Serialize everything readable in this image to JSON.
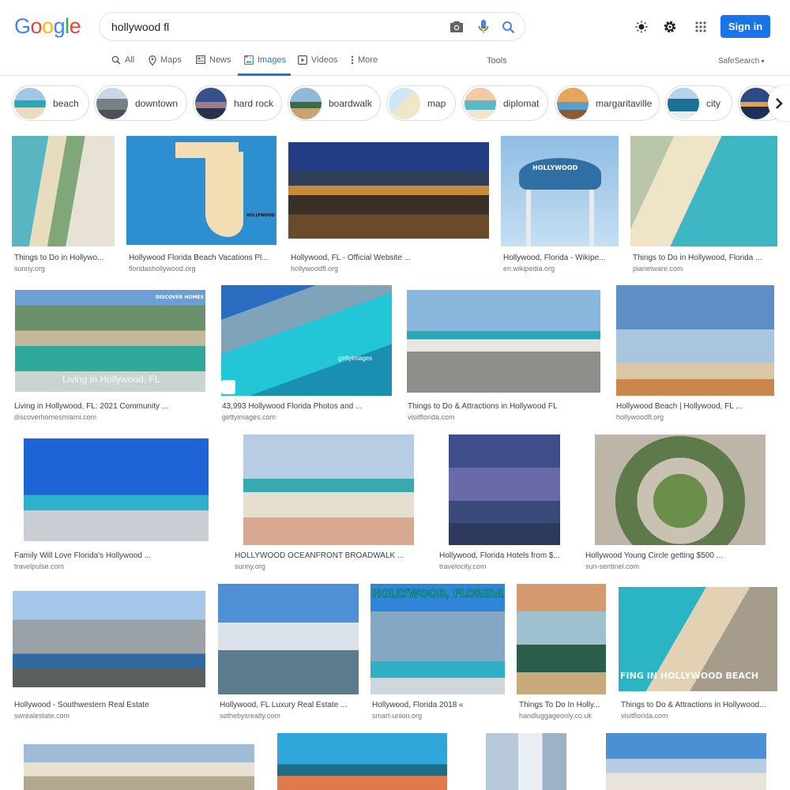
{
  "logo": {
    "letters": [
      "G",
      "o",
      "o",
      "g",
      "l",
      "e"
    ]
  },
  "search": {
    "query": "hollywood fl"
  },
  "header": {
    "signin_label": "Sign in"
  },
  "tabs": [
    {
      "label": "All",
      "icon": "search-icon"
    },
    {
      "label": "Maps",
      "icon": "map-pin-icon"
    },
    {
      "label": "News",
      "icon": "news-icon"
    },
    {
      "label": "Images",
      "icon": "image-icon",
      "active": true
    },
    {
      "label": "Videos",
      "icon": "video-icon"
    },
    {
      "label": "More",
      "icon": "more-vertical-icon"
    }
  ],
  "tools_label": "Tools",
  "safesearch_label": "SafeSearch",
  "chips": [
    {
      "label": "beach"
    },
    {
      "label": "downtown"
    },
    {
      "label": "hard rock"
    },
    {
      "label": "boardwalk"
    },
    {
      "label": "map"
    },
    {
      "label": "diplomat"
    },
    {
      "label": "margaritaville"
    },
    {
      "label": "city"
    }
  ],
  "results": [
    {
      "title": "Things to Do in Hollywo...",
      "site": "sunny.org"
    },
    {
      "title": "Hollywood Florida Beach Vacations Pl...",
      "site": "floridashollywood.org"
    },
    {
      "title": "Hollywood, FL - Official Website ...",
      "site": "hollywoodfl.org"
    },
    {
      "title": "Hollywood, Florida - Wikipe...",
      "site": "en.wikipedia.org"
    },
    {
      "title": "Things to Do in Hollywood, Florida ...",
      "site": "planetware.com"
    },
    {
      "title": "Living in Hollywood, FL: 2021 Community ...",
      "site": "discoverhomesmiami.com"
    },
    {
      "title": "43,993 Hollywood Florida Photos and ...",
      "site": "gettyimages.com"
    },
    {
      "title": "Things to Do & Attractions in Hollywood FL",
      "site": "visitflorida.com"
    },
    {
      "title": "Hollywood Beach | Hollywood, FL ...",
      "site": "hollywoodfl.org"
    },
    {
      "title": "Family Will Love Florida's Hollywood ...",
      "site": "travelpulse.com"
    },
    {
      "title": "HOLLYWOOD OCEANFRONT BROADWALK ...",
      "site": "sunny.org"
    },
    {
      "title": "Hollywood, Florida Hotels from $...",
      "site": "travelocity.com"
    },
    {
      "title": "Hollywood Young Circle getting $500 ...",
      "site": "sun-sentinel.com"
    },
    {
      "title": "Hollywood - Southwestern Real Estate",
      "site": "swrealestate.com"
    },
    {
      "title": "Hollywood, FL Luxury Real Estate ...",
      "site": "sothebysrealty.com"
    },
    {
      "title": "Hollywood, Florida 2018 «",
      "site": "smart-union.org"
    },
    {
      "title": "Things To Do In Holly...",
      "site": "handluggageonly.co.uk"
    },
    {
      "title": "Things to Do & Attractions in Hollywood...",
      "site": "visitflorida.com"
    }
  ],
  "image_overlays": {
    "discover_homes": "DISCOVER HOMES",
    "living_caption": "Living in Hollywood, FL",
    "getty": "gettyimages",
    "hollywood_florida": "HOLLYWOOD, FLORIDA",
    "surfing": "FING IN HOLLYWOOD BEACH",
    "water_tower": "HOLLYWOOD",
    "map_brand": "HOLLYWOOD"
  }
}
